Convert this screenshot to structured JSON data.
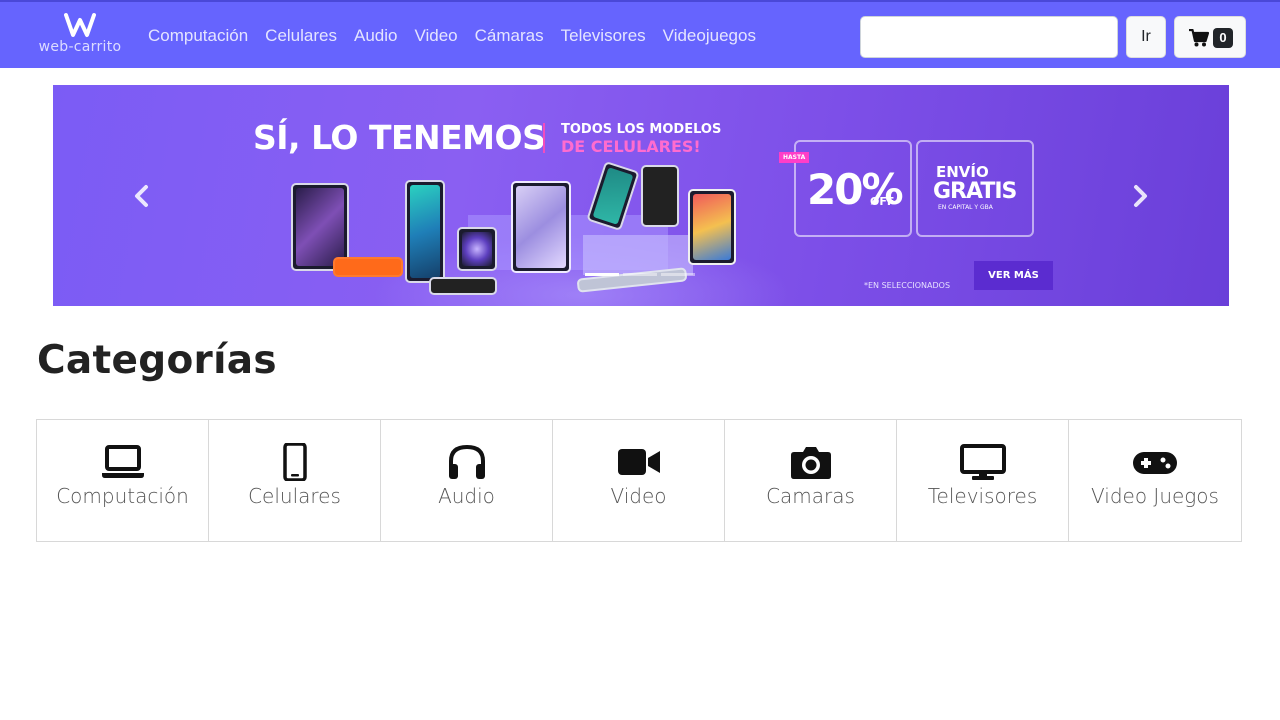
{
  "colors": {
    "navbar": "#6664fe",
    "banner": "#7d4fe8",
    "accent_pink": "#ff3ec8",
    "button_dark": "#5b2cd0"
  },
  "navbar": {
    "brand": {
      "mark": "W",
      "text": "web-carrito",
      "icon": "w-logo-icon"
    },
    "links": [
      "Computación",
      "Celulares",
      "Audio",
      "Video",
      "Cámaras",
      "Televisores",
      "Videojuegos"
    ],
    "search": {
      "value": "",
      "placeholder": ""
    },
    "search_button": "Ir",
    "cart": {
      "icon": "shopping-cart-icon",
      "count": "0"
    }
  },
  "carousel": {
    "headline": "SÍ, LO TENEMOS",
    "subhead_1": "TODOS LOS MODELOS",
    "subhead_2": "DE CELULARES!",
    "offer_tag": "HASTA",
    "offer_percent": "20%",
    "offer_suffix": "OFF",
    "shipping_1": "ENVÍO",
    "shipping_2": "GRATIS",
    "shipping_3": "EN CAPITAL Y GBA",
    "fine_print": "*EN SELECCIONADOS",
    "cta": "VER MÁS",
    "prev_icon": "chevron-left-icon",
    "next_icon": "chevron-right-icon",
    "active_slide": 1,
    "slide_count": 3
  },
  "categories": {
    "title": "Categorías",
    "items": [
      {
        "label": "Computación",
        "icon": "laptop-icon"
      },
      {
        "label": "Celulares",
        "icon": "mobile-phone-icon"
      },
      {
        "label": "Audio",
        "icon": "headphones-icon"
      },
      {
        "label": "Video",
        "icon": "video-camera-icon"
      },
      {
        "label": "Camaras",
        "icon": "camera-icon"
      },
      {
        "label": "Televisores",
        "icon": "tv-icon"
      },
      {
        "label": "Video Juegos",
        "icon": "gamepad-icon"
      }
    ]
  }
}
